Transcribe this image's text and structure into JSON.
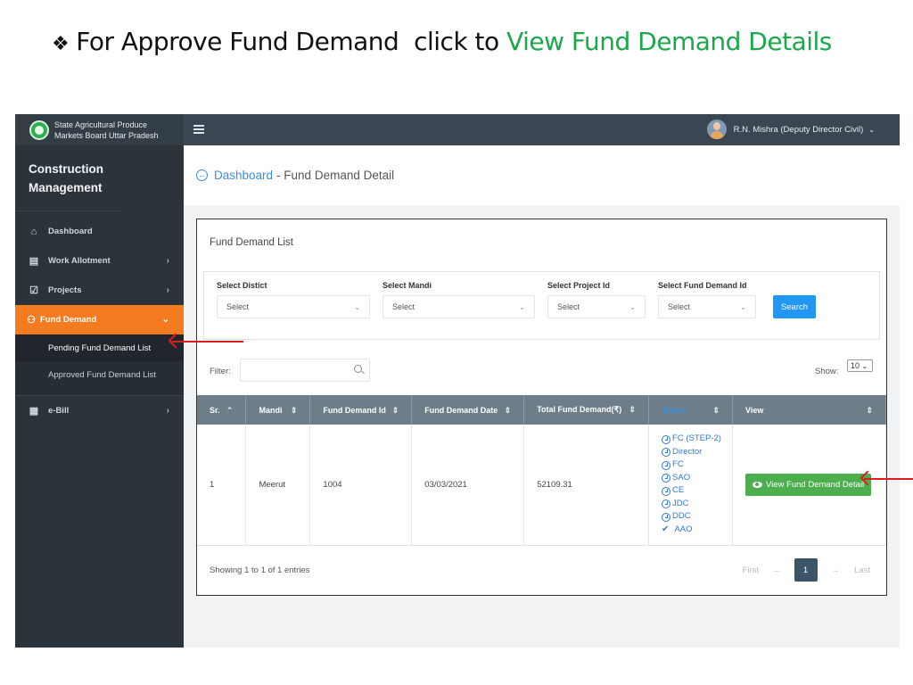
{
  "slide": {
    "bullet": "❖",
    "title_prefix": "For Approve Fund Demand  click to ",
    "title_highlight": "View Fund Demand Details"
  },
  "header": {
    "brand_line1": "State Agricultural Produce",
    "brand_line2": "Markets Board Uttar Pradesh",
    "user_name": "R.N. Mishra (Deputy Director Civil)"
  },
  "sidebar": {
    "title": "Construction Management",
    "items": [
      {
        "label": "Dashboard",
        "icon": "home-icon",
        "arrow": ""
      },
      {
        "label": "Work Allotment",
        "icon": "document-icon",
        "arrow": "›"
      },
      {
        "label": "Projects",
        "icon": "checkbox-icon",
        "arrow": "›"
      },
      {
        "label": "Fund Demand",
        "icon": "hand-money-icon",
        "arrow": "⌄"
      },
      {
        "label": "e-Bill",
        "icon": "clipboard-icon",
        "arrow": "›"
      }
    ],
    "submenu": [
      {
        "label": "Pending Fund Demand List"
      },
      {
        "label": "Approved Fund Demand List"
      }
    ]
  },
  "breadcrumb": {
    "link": "Dashboard",
    "current": "- Fund Demand Detail"
  },
  "panel": {
    "title": "Fund Demand List",
    "filters": [
      {
        "label": "Select Distict",
        "value": "Select"
      },
      {
        "label": "Select Mandi",
        "value": "Select"
      },
      {
        "label": "Select Project Id",
        "value": "Select"
      },
      {
        "label": "Select Fund Demand Id",
        "value": "Select"
      }
    ],
    "search_label": "Search",
    "filter_label": "Filter:",
    "filter_value": "",
    "show_label": "Show:",
    "show_value": "10"
  },
  "table": {
    "columns": [
      "Sr.",
      "Mandi",
      "Fund Demand Id",
      "Fund Demand Date",
      "Total Fund Demand(₹)",
      "Status",
      "View"
    ],
    "rows": [
      {
        "sr": "1",
        "mandi": "Meerut",
        "fund_demand_id": "1004",
        "date": "03/03/2021",
        "total": "52109.31",
        "status": [
          {
            "label": "FC (STEP-2)",
            "state": "pending"
          },
          {
            "label": "Director",
            "state": "pending"
          },
          {
            "label": "FC",
            "state": "pending"
          },
          {
            "label": "SAO",
            "state": "pending"
          },
          {
            "label": "CE",
            "state": "pending"
          },
          {
            "label": "JDC",
            "state": "pending"
          },
          {
            "label": "DDC",
            "state": "pending"
          },
          {
            "label": "AAO",
            "state": "done"
          }
        ],
        "view_label": "View Fund Demand Detail"
      }
    ]
  },
  "footer": {
    "showing": "Showing 1 to 1 of 1 entries",
    "first": "First",
    "prev": "←",
    "page": "1",
    "next": "→",
    "last": "Last"
  }
}
